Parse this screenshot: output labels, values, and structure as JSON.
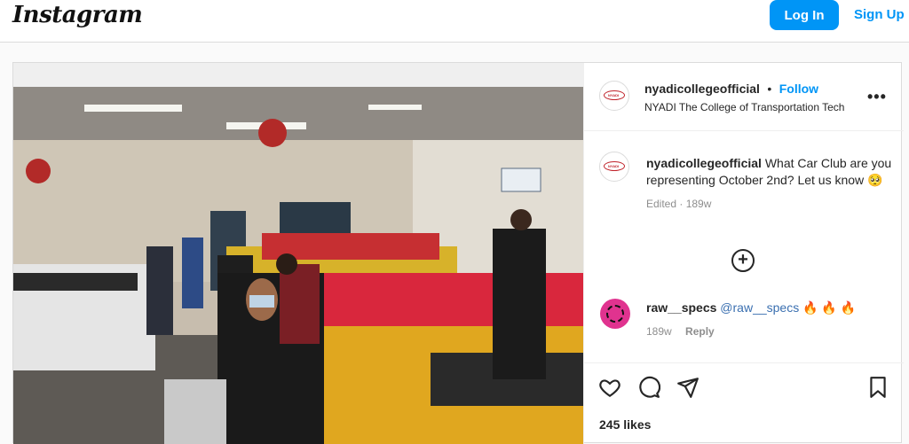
{
  "topbar": {
    "logo": "Instagram",
    "login_label": "Log In",
    "signup_label": "Sign Up"
  },
  "post": {
    "author": {
      "username": "nyadicollegeofficial",
      "separator": "•",
      "follow_label": "Follow",
      "subtitle": "NYADI The College of Transportation Tech"
    },
    "caption": {
      "username": "nyadicollegeofficial",
      "text": "What Car Club are you representing October 2nd? Let us know 🥺",
      "meta": "Edited · 189w"
    },
    "load_more_icon": "plus-circle-icon",
    "comments": [
      {
        "username": "raw__specs",
        "mention": "@raw__specs",
        "emoji": "🔥 🔥 🔥",
        "time": "189w",
        "reply_label": "Reply"
      }
    ],
    "actions": {
      "icons": [
        "heart-icon",
        "comment-icon",
        "share-icon",
        "bookmark-icon"
      ]
    },
    "likes": "245 likes"
  },
  "colors": {
    "accent": "#0095f6",
    "border": "#dbdbdb",
    "muted": "#8e8e8e"
  }
}
